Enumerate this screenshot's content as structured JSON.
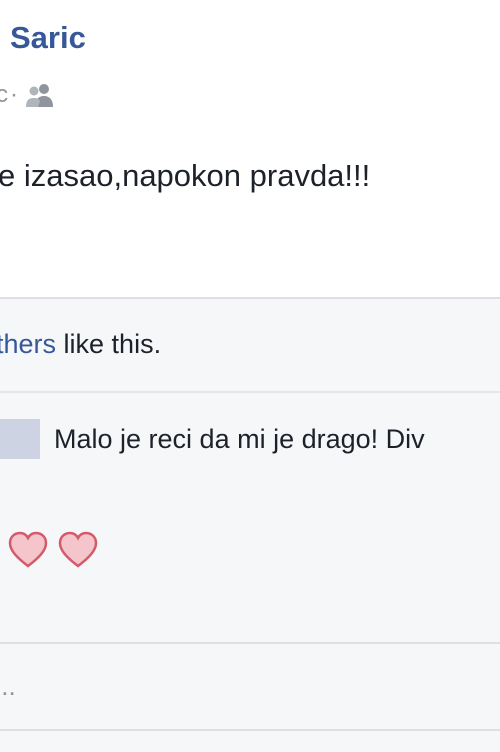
{
  "post": {
    "author": "Saric",
    "meta_fragment": "c",
    "meta_separator": "·",
    "audience_icon": "friends-icon",
    "text": "e izasao,napokon pravda!!!"
  },
  "feedback": {
    "likes_link": "thers",
    "likes_suffix": " like this."
  },
  "comment": {
    "text": "Malo je reci da mi je drago! Div",
    "reaction_icons": [
      "heart-icon",
      "heart-icon"
    ],
    "colors": {
      "heart_fill": "#f4c6cc",
      "heart_stroke": "#d45a6a"
    }
  },
  "composer": {
    "placeholder": "..."
  },
  "colors": {
    "link": "#365899",
    "text": "#1d2129",
    "muted": "#90949c",
    "panel_bg": "#f6f7f9",
    "avatar_bg": "#cdd3e2"
  }
}
